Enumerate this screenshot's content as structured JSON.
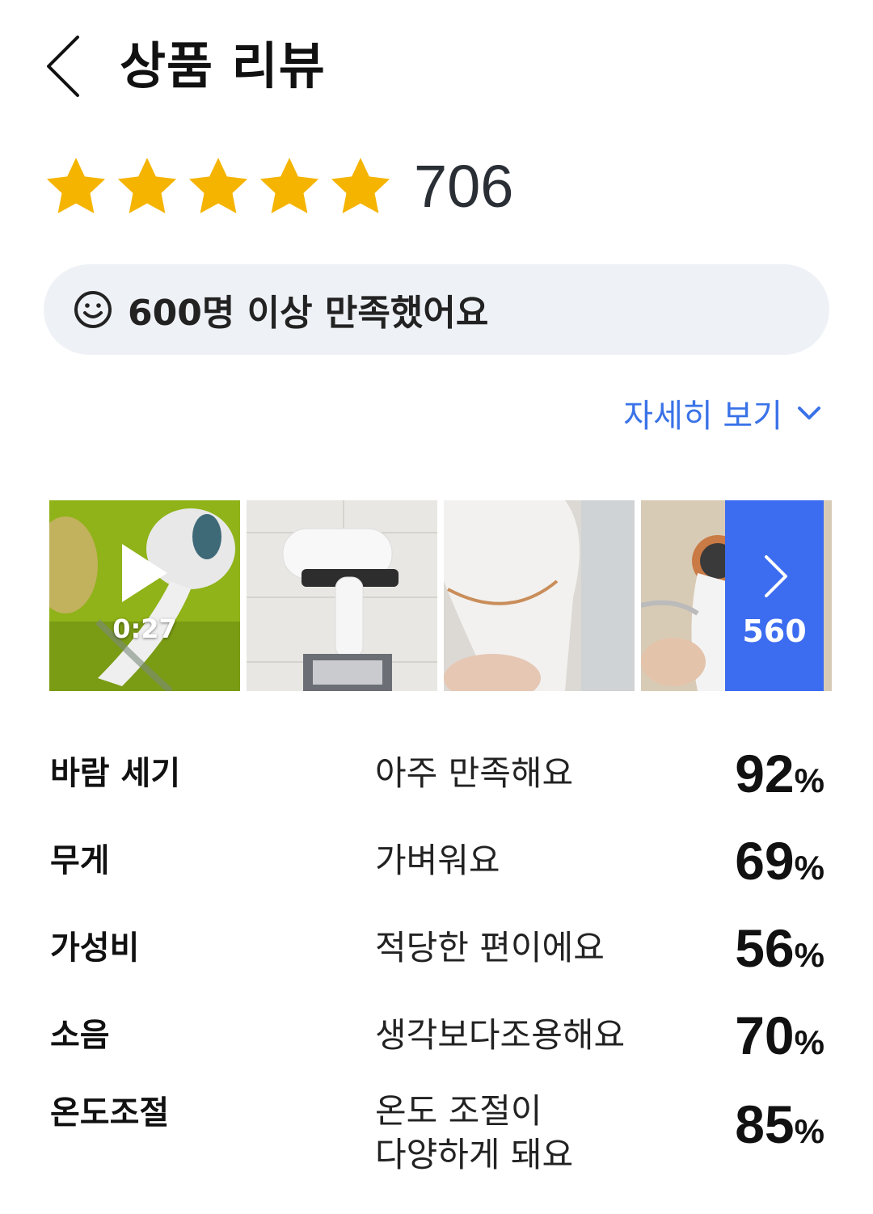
{
  "header": {
    "title": "상품 리뷰"
  },
  "rating": {
    "stars": 5,
    "max_stars": 5,
    "count": "706",
    "star_color": "#f5b400"
  },
  "satisfaction": {
    "text": "600명 이상 만족했어요"
  },
  "more_link": {
    "label": "자세히 보기",
    "color": "#3a72e8"
  },
  "photos": {
    "video_duration": "0:27",
    "more_count": "560",
    "more_bg": "#3c6cf0"
  },
  "stats": [
    {
      "label": "바람 세기",
      "desc": "아주 만족해요",
      "value": "92",
      "unit": "%"
    },
    {
      "label": "무게",
      "desc": "가벼워요",
      "value": "69",
      "unit": "%"
    },
    {
      "label": "가성비",
      "desc": "적당한 편이에요",
      "value": "56",
      "unit": "%"
    },
    {
      "label": "소음",
      "desc": "생각보다조용해요",
      "value": "70",
      "unit": "%"
    },
    {
      "label": "온도조절",
      "desc_line1": "온도 조절이",
      "desc_line2": "다양하게 돼요",
      "value": "85",
      "unit": "%"
    }
  ]
}
